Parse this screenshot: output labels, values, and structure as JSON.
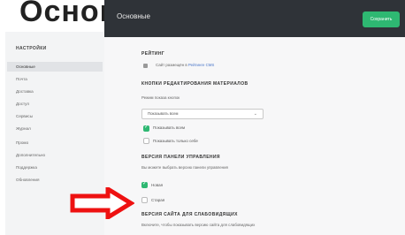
{
  "headline": {
    "text": "Основные функции"
  },
  "topbar": {
    "title": "Основные",
    "save_label": "Сохранить"
  },
  "sidebar": {
    "heading": "НАСТРОЙКИ",
    "items": [
      {
        "label": "Основные",
        "active": true
      },
      {
        "label": "Почта"
      },
      {
        "label": "Доставка"
      },
      {
        "label": "Доступ"
      },
      {
        "label": "Сервисы"
      },
      {
        "label": "Журнал"
      },
      {
        "label": "Промо"
      },
      {
        "label": "Дополнительно"
      },
      {
        "label": "Поддержка"
      },
      {
        "label": "Обновления"
      }
    ]
  },
  "sections": {
    "s1": {
      "heading": "РЕЙТИНГ",
      "text": "Сайт размещён в",
      "link": "Рейтинге CMS"
    },
    "s2": {
      "heading": "КНОПКИ РЕДАКТИРОВАНИЯ МАТЕРИАЛОВ",
      "field_label": "Режим показа кнопок",
      "select_value": "Показывать всем",
      "opt1": "Показывать всем",
      "opt2": "Показывать только себе"
    },
    "s3": {
      "heading": "ВЕРСИЯ ПАНЕЛИ УПРАВЛЕНИЯ",
      "desc": "Вы можете выбрать версию панели управления",
      "opt_new": "Новая",
      "opt_old": "Старая"
    },
    "s4": {
      "heading": "ВЕРСИЯ САЙТА ДЛЯ СЛАБОВИДЯЩИХ",
      "desc": "Включите, чтобы показывать версию сайта для слабовидящих"
    }
  },
  "colors": {
    "accent": "#2eb872",
    "topbar": "#2f3338",
    "arrow": "#ee1111"
  }
}
